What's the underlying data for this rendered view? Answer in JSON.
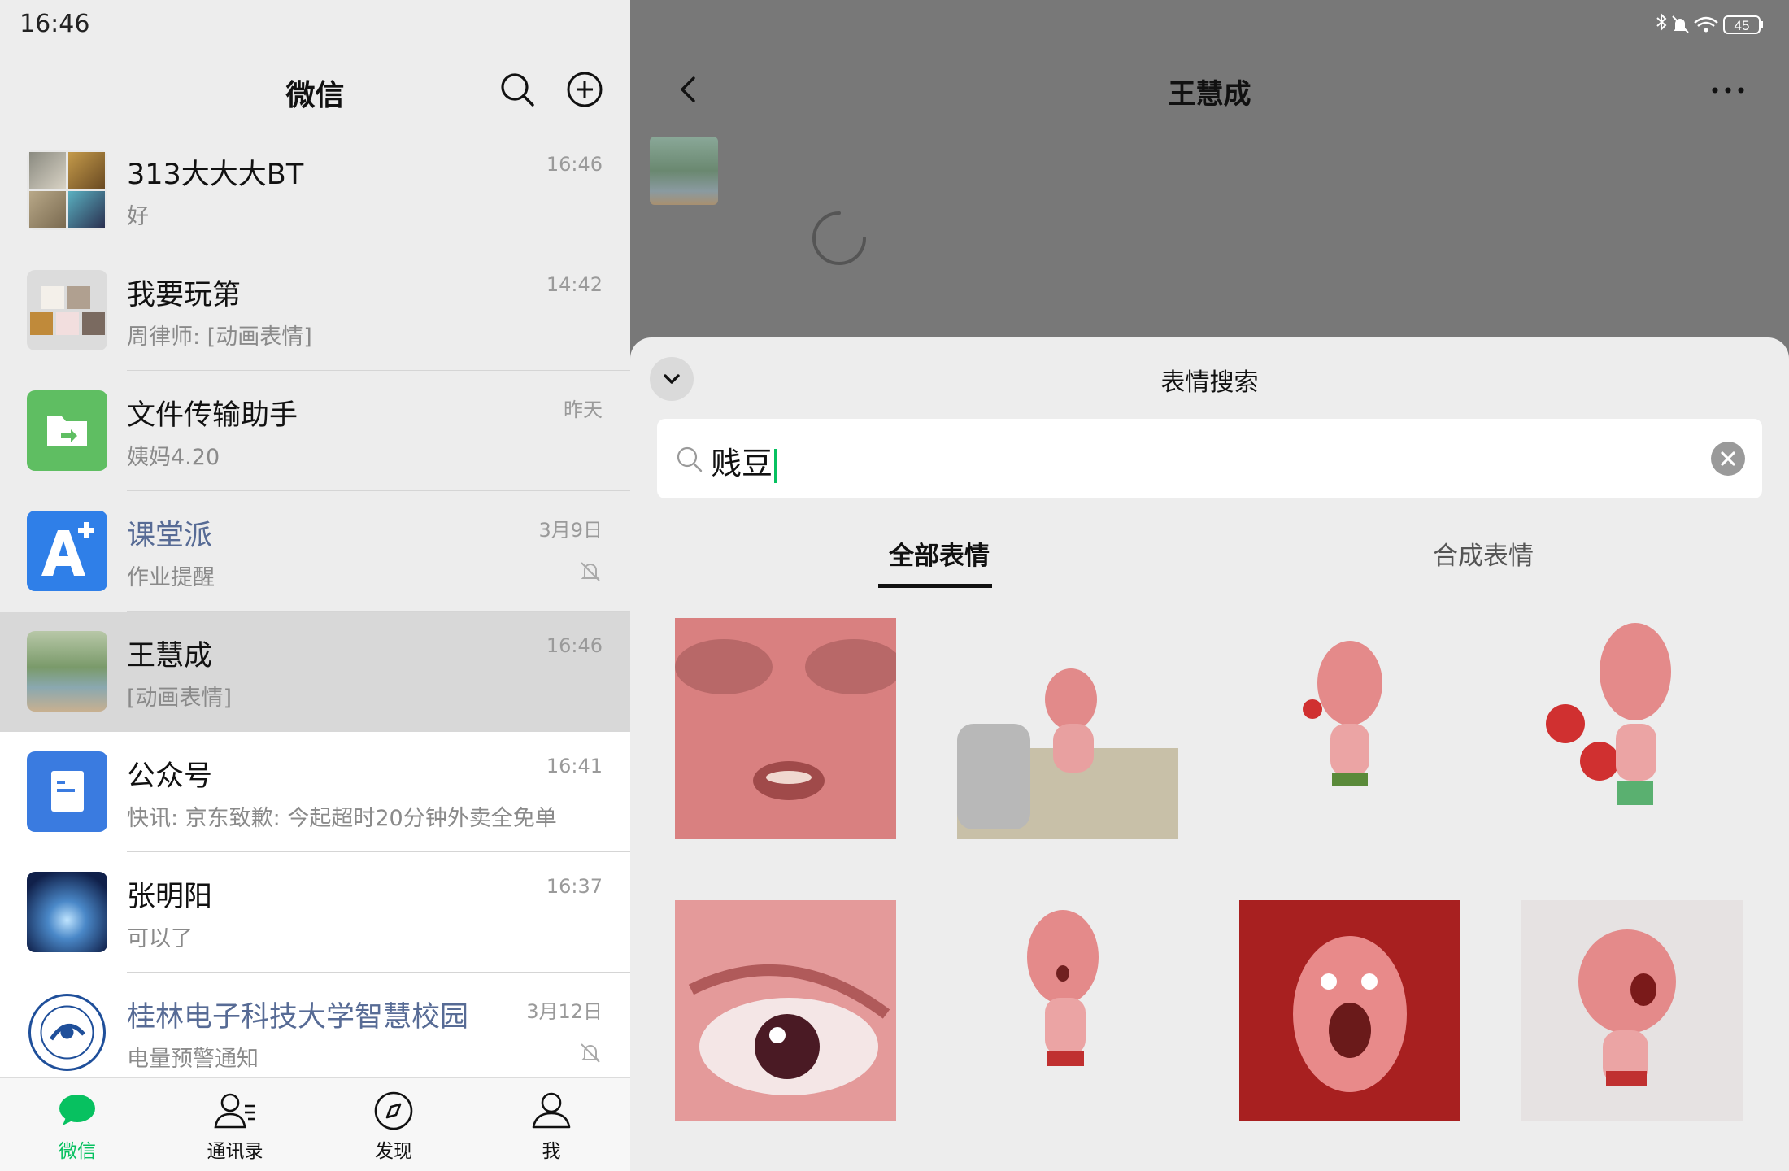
{
  "status": {
    "time": "16:46",
    "battery": "45"
  },
  "left": {
    "title": "微信",
    "chats": [
      {
        "name": "313大大大BT",
        "preview": "好",
        "time": "16:46",
        "muted": false,
        "name_link": false
      },
      {
        "name": "我要玩第",
        "preview": "周律师: [动画表情]",
        "time": "14:42",
        "muted": false,
        "name_link": false
      },
      {
        "name": "文件传输助手",
        "preview": "姨妈4.20",
        "time": "昨天",
        "muted": false,
        "name_link": false
      },
      {
        "name": "课堂派",
        "preview": "作业提醒",
        "time": "3月9日",
        "muted": true,
        "name_link": true
      },
      {
        "name": "王慧成",
        "preview": "[动画表情]",
        "time": "16:46",
        "muted": false,
        "name_link": false
      },
      {
        "name": "公众号",
        "preview": "快讯: 京东致歉: 今起超时20分钟外卖全免单",
        "time": "16:41",
        "muted": false,
        "name_link": false
      },
      {
        "name": "张明阳",
        "preview": "可以了",
        "time": "16:37",
        "muted": false,
        "name_link": false
      },
      {
        "name": "桂林电子科技大学智慧校园",
        "preview": "电量预警通知",
        "time": "3月12日",
        "muted": true,
        "name_link": true
      }
    ],
    "tabs": [
      {
        "label": "微信",
        "icon": "chat-bubble-icon"
      },
      {
        "label": "通讯录",
        "icon": "contacts-icon"
      },
      {
        "label": "发现",
        "icon": "compass-icon"
      },
      {
        "label": "我",
        "icon": "person-icon"
      }
    ]
  },
  "right": {
    "title": "王慧成",
    "sheet": {
      "title": "表情搜索",
      "search_value": "贱豆",
      "tabs": [
        "全部表情",
        "合成表情"
      ]
    }
  },
  "colors": {
    "accent": "#07c160",
    "link": "#576b95"
  }
}
